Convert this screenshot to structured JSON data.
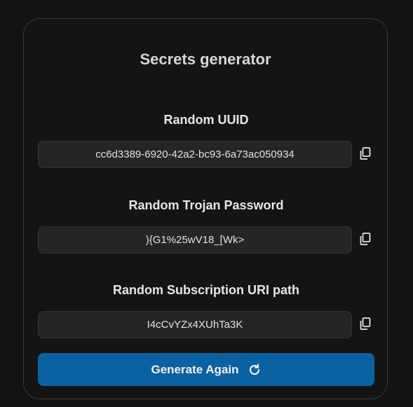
{
  "card": {
    "title": "Secrets generator"
  },
  "fields": [
    {
      "label": "Random UUID",
      "value": "cc6d3389-6920-42a2-bc93-6a73ac050934",
      "copy_icon": "copy-icon"
    },
    {
      "label": "Random Trojan Password",
      "value": "){G1%25wV18_[Wk>",
      "copy_icon": "copy-icon"
    },
    {
      "label": "Random Subscription URI path",
      "value": "I4cCvYZx4XUhTa3K",
      "copy_icon": "copy-icon"
    }
  ],
  "actions": {
    "generate_label": "Generate Again",
    "generate_icon": "refresh-icon"
  },
  "colors": {
    "background": "#131313",
    "card": "#141414",
    "field": "#252525",
    "accent": "#0b62a2"
  }
}
